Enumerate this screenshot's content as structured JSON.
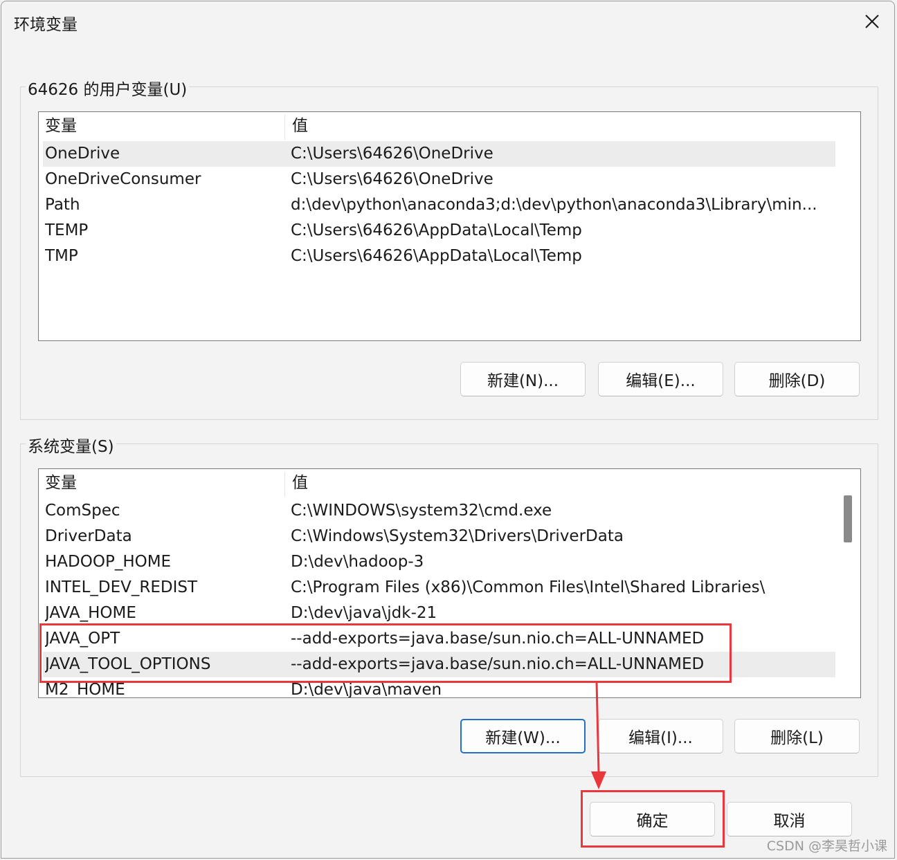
{
  "window": {
    "title": "环境变量"
  },
  "user_vars": {
    "label": "64626 的用户变量(U)",
    "columns": [
      "变量",
      "值"
    ],
    "rows": [
      {
        "name": "OneDrive",
        "value": "C:\\Users\\64626\\OneDrive"
      },
      {
        "name": "OneDriveConsumer",
        "value": "C:\\Users\\64626\\OneDrive"
      },
      {
        "name": "Path",
        "value": "d:\\dev\\python\\anaconda3;d:\\dev\\python\\anaconda3\\Library\\min..."
      },
      {
        "name": "TEMP",
        "value": "C:\\Users\\64626\\AppData\\Local\\Temp"
      },
      {
        "name": "TMP",
        "value": "C:\\Users\\64626\\AppData\\Local\\Temp"
      }
    ],
    "buttons": {
      "new": "新建(N)...",
      "edit": "编辑(E)...",
      "delete": "删除(D)"
    }
  },
  "system_vars": {
    "label": "系统变量(S)",
    "columns": [
      "变量",
      "值"
    ],
    "rows": [
      {
        "name": "ComSpec",
        "value": "C:\\WINDOWS\\system32\\cmd.exe"
      },
      {
        "name": "DriverData",
        "value": "C:\\Windows\\System32\\Drivers\\DriverData"
      },
      {
        "name": "HADOOP_HOME",
        "value": "D:\\dev\\hadoop-3"
      },
      {
        "name": "INTEL_DEV_REDIST",
        "value": "C:\\Program Files (x86)\\Common Files\\Intel\\Shared Libraries\\"
      },
      {
        "name": "JAVA_HOME",
        "value": "D:\\dev\\java\\jdk-21"
      },
      {
        "name": "JAVA_OPT",
        "value": "--add-exports=java.base/sun.nio.ch=ALL-UNNAMED"
      },
      {
        "name": "JAVA_TOOL_OPTIONS",
        "value": "--add-exports=java.base/sun.nio.ch=ALL-UNNAMED"
      },
      {
        "name": "M2_HOME",
        "value": "D:\\dev\\java\\maven"
      }
    ],
    "buttons": {
      "new": "新建(W)...",
      "edit": "编辑(I)...",
      "delete": "删除(L)"
    }
  },
  "dialog_buttons": {
    "ok": "确定",
    "cancel": "取消"
  },
  "watermark": "CSDN @李昊哲小课",
  "colors": {
    "annotation_red": "#e8383b",
    "focus_blue": "#1f6fc5",
    "selected_row": "#ececec"
  }
}
